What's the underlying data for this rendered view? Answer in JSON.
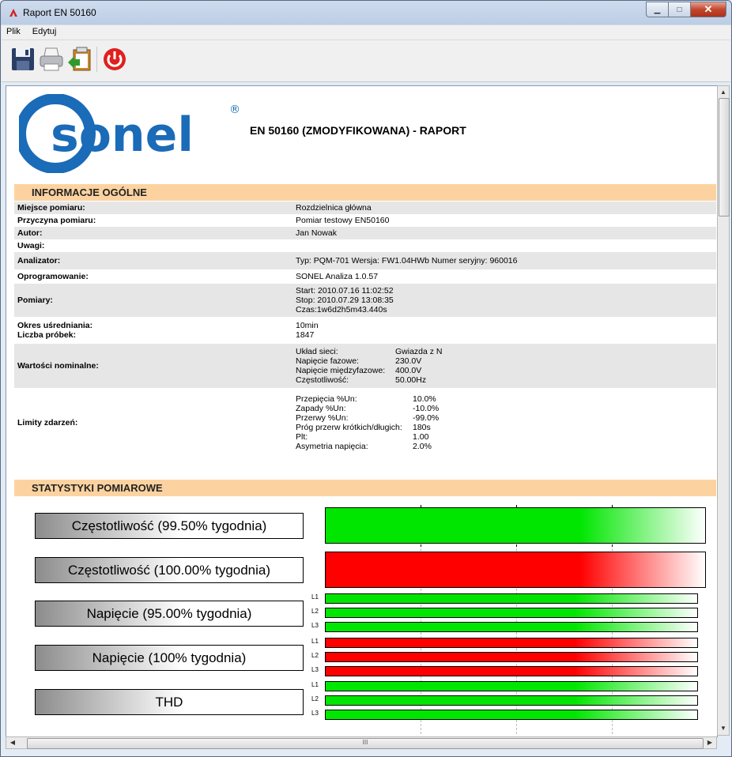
{
  "window": {
    "title": "Raport EN 50160"
  },
  "menu": [
    "Plik",
    "Edytuj"
  ],
  "toolbar": {
    "icons": [
      "save-icon",
      "print-icon",
      "export-icon",
      "exit-icon"
    ]
  },
  "report": {
    "logo_text": "sonel",
    "title": "EN 50160 (ZMODYFIKOWANA) - RAPORT",
    "general_header": "INFORMACJE OGÓLNE",
    "rows": [
      {
        "label": "Miejsce pomiaru:",
        "value": "Rozdzielnica główna"
      },
      {
        "label": "Przyczyna pomiaru:",
        "value": "Pomiar testowy EN50160"
      },
      {
        "label": "Autor:",
        "value": "Jan Nowak"
      },
      {
        "label": "Uwagi:",
        "value": ""
      },
      {
        "label": "Analizator:",
        "value": "Typ: PQM-701 Wersja: FW1.04HWb Numer seryjny: 960016"
      },
      {
        "label": "Oprogramowanie:",
        "value": "SONEL Analiza 1.0.57"
      }
    ],
    "pomiary": {
      "label": "Pomiary:",
      "lines": [
        "Start: 2010.07.16 11:02:52",
        "Stop: 2010.07.29 13:08:35",
        "Czas:1w6d2h5m43.440s"
      ]
    },
    "okres": {
      "label1": "Okres uśredniania:",
      "label2": "Liczba próbek:",
      "value1": "10min",
      "value2": "1847"
    },
    "nominal": {
      "label": "Wartości nominalne:",
      "items": [
        {
          "k": "Układ sieci:",
          "v": "Gwiazda z N"
        },
        {
          "k": "Napięcie fazowe:",
          "v": "230.0V"
        },
        {
          "k": "Napięcie międzyfazowe:",
          "v": "400.0V"
        },
        {
          "k": "Częstotliwość:",
          "v": "50.00Hz"
        }
      ]
    },
    "limits": {
      "label": "Limity zdarzeń:",
      "items": [
        {
          "k": "Przepięcia %Un:",
          "v": "10.0%"
        },
        {
          "k": "Zapady %Un:",
          "v": "-10.0%"
        },
        {
          "k": "Przerwy %Un:",
          "v": "-99.0%"
        },
        {
          "k": "Próg przerw krótkich/długich:",
          "v": "180s"
        },
        {
          "k": "Plt:",
          "v": "1.00"
        },
        {
          "k": "Asymetria napięcia:",
          "v": "2.0%"
        }
      ]
    },
    "stats_header": "STATYSTYKI POMIAROWE",
    "stats": [
      {
        "label": "Częstotliwość (99.50% tygodnia)"
      },
      {
        "label": "Częstotliwość (100.00% tygodnia)"
      },
      {
        "label": "Napięcie (95.00% tygodnia)"
      },
      {
        "label": "Napięcie (100% tygodnia)"
      },
      {
        "label": "THD"
      }
    ],
    "phases": [
      "L1",
      "L2",
      "L3"
    ]
  },
  "scrollbar": {
    "grip": "III"
  }
}
